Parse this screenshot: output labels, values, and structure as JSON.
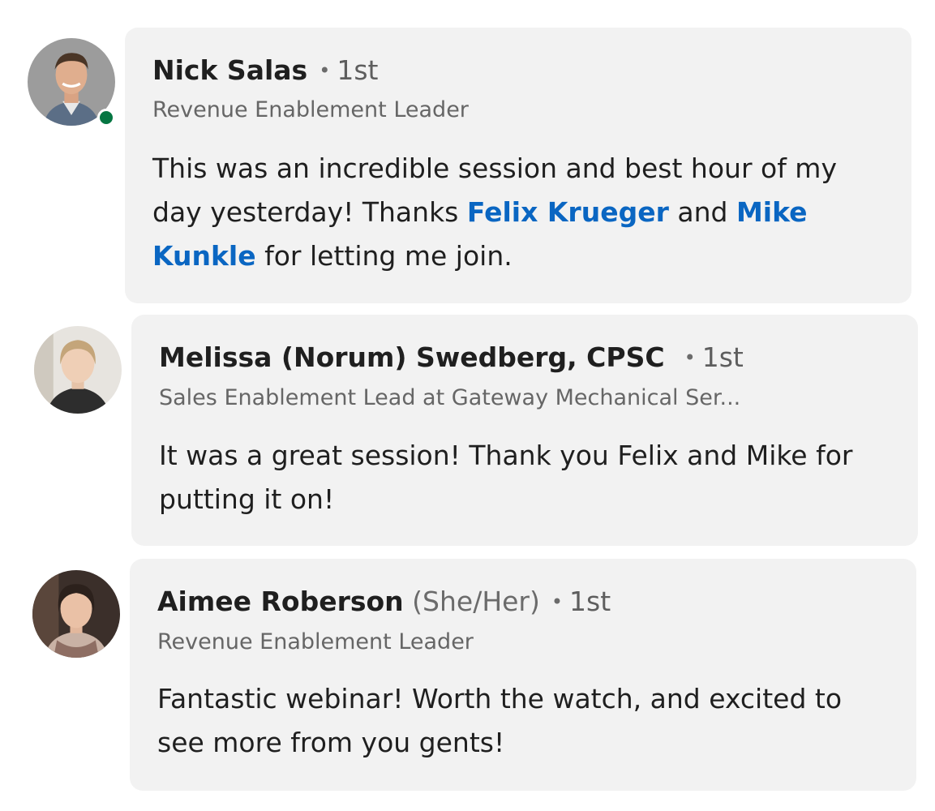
{
  "comments": [
    {
      "author": "Nick Salas",
      "degree": "1st",
      "headline": "Revenue Enablement Leader",
      "online": true,
      "text_parts": [
        "This was an incredible session and best hour of my day yesterday! Thanks ",
        " and ",
        " for letting me join."
      ],
      "mentions": [
        "Felix Krueger",
        "Mike Kunkle"
      ]
    },
    {
      "author": "Melissa (Norum) Swedberg, CPSC",
      "degree": "1st",
      "headline": "Sales Enablement Lead at Gateway Mechanical Ser...",
      "text": "It was a great session! Thank you Felix and Mike for putting it on!"
    },
    {
      "author": "Aimee Roberson",
      "pronouns": "(She/Her)",
      "degree": "1st",
      "headline": "Revenue Enablement Leader",
      "text": "Fantastic webinar! Worth the watch, and excited to see more from you gents!"
    }
  ],
  "separator": "•",
  "colors": {
    "bubble": "#f2f2f2",
    "mention": "#0a66c2",
    "presence": "#057642"
  }
}
